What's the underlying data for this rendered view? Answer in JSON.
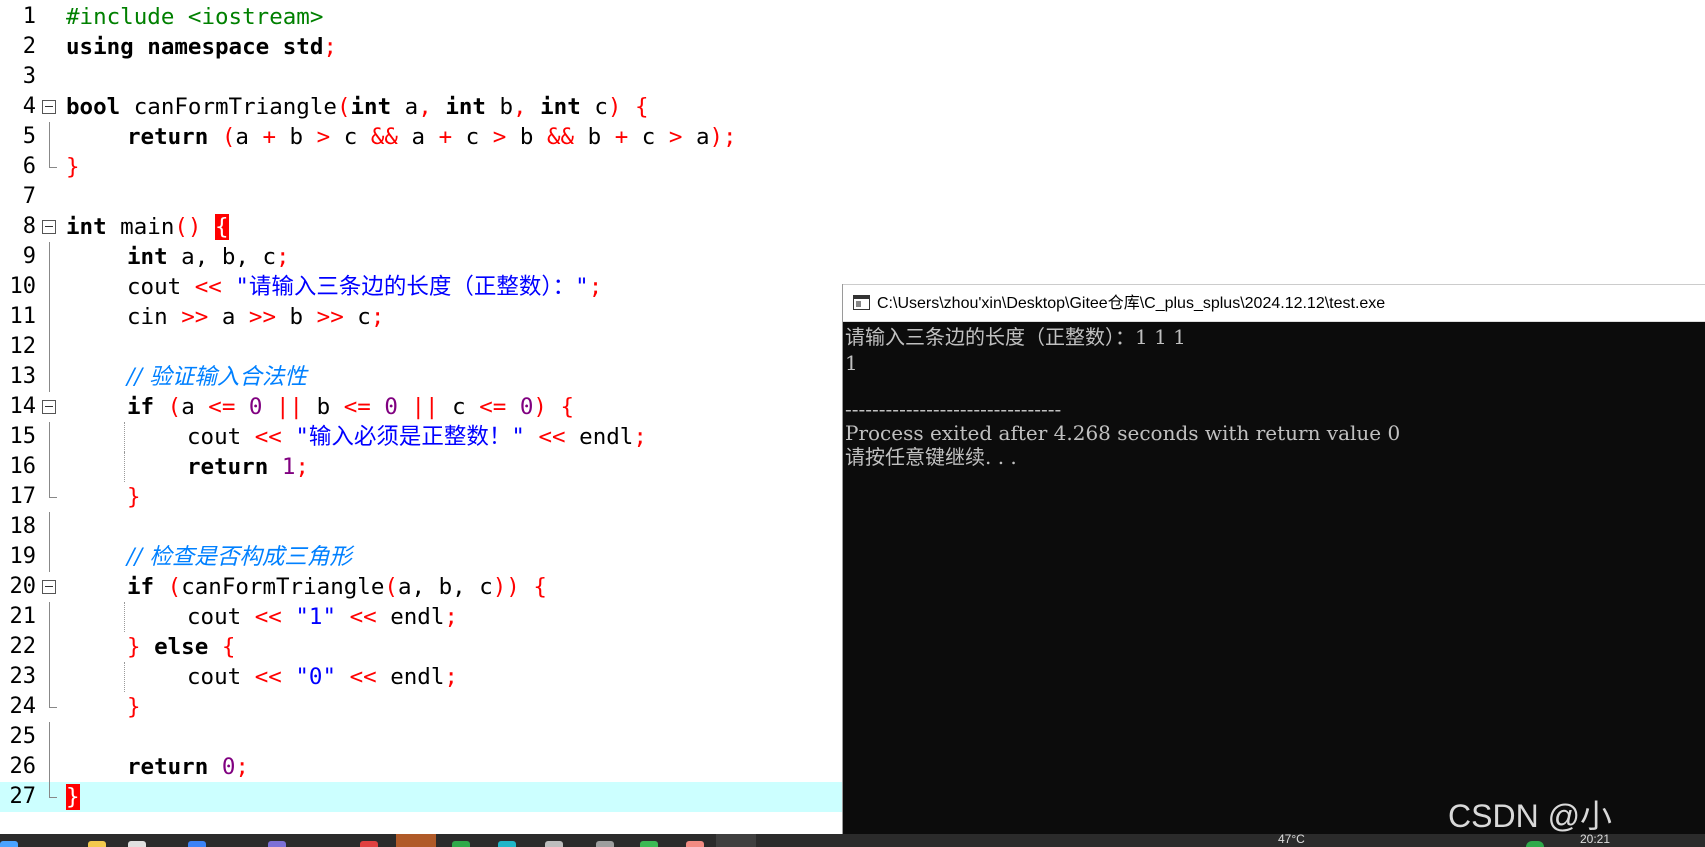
{
  "editor": {
    "lines": [
      {
        "num": "1"
      },
      {
        "num": "2"
      },
      {
        "num": "3"
      },
      {
        "num": "4"
      },
      {
        "num": "5"
      },
      {
        "num": "6"
      },
      {
        "num": "7"
      },
      {
        "num": "8"
      },
      {
        "num": "9"
      },
      {
        "num": "10"
      },
      {
        "num": "11"
      },
      {
        "num": "12"
      },
      {
        "num": "13"
      },
      {
        "num": "14"
      },
      {
        "num": "15"
      },
      {
        "num": "16"
      },
      {
        "num": "17"
      },
      {
        "num": "18"
      },
      {
        "num": "19"
      },
      {
        "num": "20"
      },
      {
        "num": "21"
      },
      {
        "num": "22"
      },
      {
        "num": "23"
      },
      {
        "num": "24"
      },
      {
        "num": "25"
      },
      {
        "num": "26"
      },
      {
        "num": "27"
      }
    ],
    "tokens": {
      "l1_pre": "#include <iostream>",
      "l2_using": "using",
      "l2_namespace": "namespace",
      "l2_std": " std",
      "l2_semi": ";",
      "l4_bool": "bool",
      "l4_name": " canFormTriangle",
      "l4_lparen": "(",
      "l4_int1": "int",
      "l4_a": " a",
      "l4_c1": ", ",
      "l4_int2": "int",
      "l4_b": " b",
      "l4_c2": ", ",
      "l4_int3": "int",
      "l4_c": " c",
      "l4_rparen": ") {",
      "l5_return": "return",
      "l5_lp": " (",
      "l5_a1": "a ",
      "l5_p1": "+",
      "l5_b1": " b ",
      "l5_g1": ">",
      "l5_c1": " c ",
      "l5_and1": "&&",
      "l5_a2": " a ",
      "l5_p2": "+",
      "l5_c2": " c ",
      "l5_g2": ">",
      "l5_b2": " b ",
      "l5_and2": "&&",
      "l5_b3": " b ",
      "l5_p3": "+",
      "l5_c3": " c ",
      "l5_g3": ">",
      "l5_a3": " a",
      "l5_end": ");",
      "l6_brace": "}",
      "l8_int": "int",
      "l8_main": " main",
      "l8_parens": "()",
      "l8_brace": "{",
      "l9_int": "int",
      "l9_vars": " a, b, c",
      "l9_semi": ";",
      "l10_cout": "cout ",
      "l10_op": "<<",
      "l10_str": " \"请输入三条边的长度（正整数）：\"",
      "l10_semi": ";",
      "l11_cin": "cin ",
      "l11_op1": ">>",
      "l11_a": " a ",
      "l11_op2": ">>",
      "l11_b": " b ",
      "l11_op3": ">>",
      "l11_c": " c",
      "l11_semi": ";",
      "l13_cmt": "// 验证输入合法性",
      "l14_if": "if",
      "l14_lp": " (",
      "l14_a": "a ",
      "l14_le1": "<=",
      "l14_z1": " 0 ",
      "l14_or1": "||",
      "l14_b": " b ",
      "l14_le2": "<=",
      "l14_z2": " 0 ",
      "l14_or2": "||",
      "l14_c": " c ",
      "l14_le3": "<=",
      "l14_z3": " 0",
      "l14_end": ") {",
      "l15_cout": "cout ",
      "l15_op1": "<<",
      "l15_str": " \"输入必须是正整数！\" ",
      "l15_op2": "<<",
      "l15_endl": " endl",
      "l15_semi": ";",
      "l16_return": "return",
      "l16_num": " 1",
      "l16_semi": ";",
      "l17_brace": "}",
      "l19_cmt": "// 检查是否构成三角形",
      "l20_if": "if",
      "l20_lp": " (",
      "l20_name": "canFormTriangle",
      "l20_lp2": "(",
      "l20_args": "a, b, c",
      "l20_end": ")) {",
      "l21_cout": "cout ",
      "l21_op1": "<<",
      "l21_str": " \"1\" ",
      "l21_op2": "<<",
      "l21_endl": " endl",
      "l21_semi": ";",
      "l22_close": "} ",
      "l22_else": "else",
      "l22_open": " {",
      "l23_cout": "cout ",
      "l23_op1": "<<",
      "l23_str": " \"0\" ",
      "l23_op2": "<<",
      "l23_endl": " endl",
      "l23_semi": ";",
      "l24_brace": "}",
      "l26_return": "return",
      "l26_num": " 0",
      "l26_semi": ";",
      "l27_brace": "}"
    }
  },
  "console": {
    "title": "C:\\Users\\zhou'xin\\Desktop\\Gitee仓库\\C_plus_splus\\2024.12.12\\test.exe",
    "lines": [
      "请输入三条边的长度（正整数）：1 1 1",
      "1",
      "",
      "--------------------------------",
      "Process exited after 4.268 seconds with return value 0",
      "请按任意键继续. . ."
    ]
  },
  "watermark": "CSDN @小",
  "taskbar": {
    "weather": "47°C",
    "clock": "20:21"
  },
  "colors": {
    "keyword": "#000000",
    "preprocessor": "#008000",
    "operator": "#ff0000",
    "string": "#0000ff",
    "number": "#800080",
    "comment": "#0080ff",
    "current_line": "#ccffff",
    "console_bg": "#0c0c0c",
    "console_text": "#c0c0c0"
  }
}
